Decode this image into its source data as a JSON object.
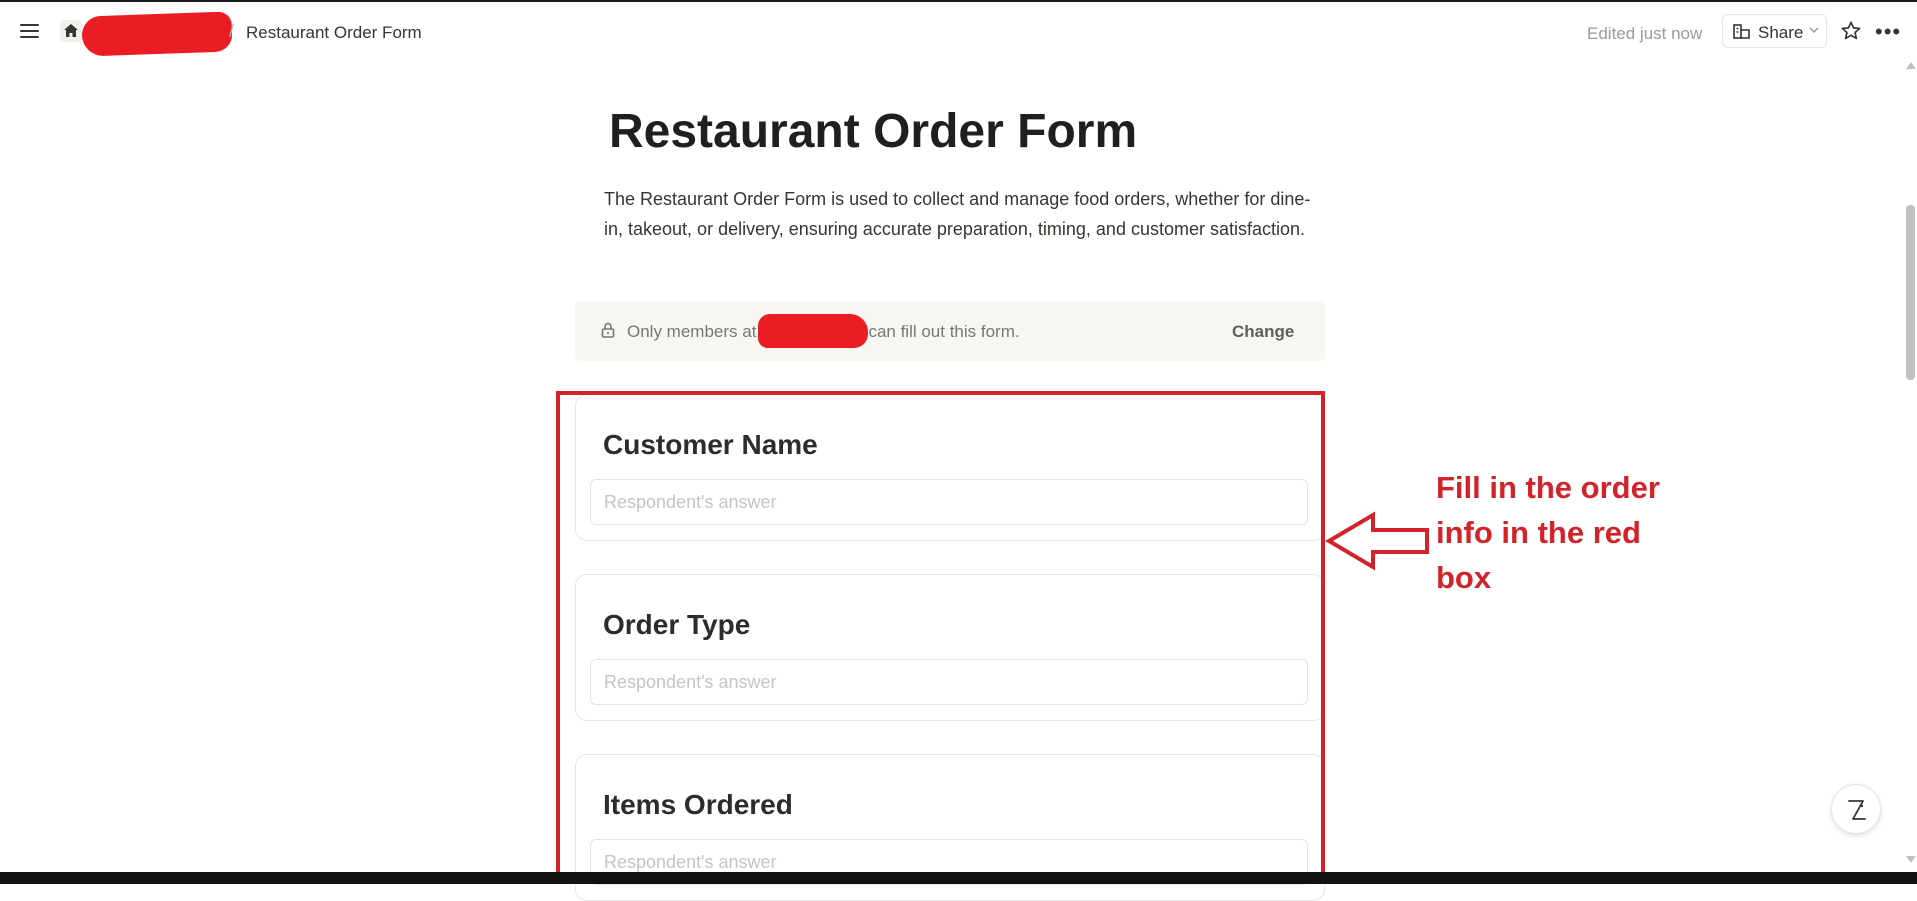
{
  "header": {
    "breadcrumb_title": "Restaurant Order Form",
    "breadcrumb_separator": "/",
    "edited_status": "Edited just now",
    "share_label": "Share",
    "more_label": "•••"
  },
  "page": {
    "title": "Restaurant Order Form",
    "description": "The Restaurant Order Form is used to collect and manage food orders, whether for dine-in, takeout, or delivery, ensuring accurate preparation, timing, and customer satisfaction."
  },
  "notice": {
    "prefix": "Only members at",
    "suffix": "can fill out this form.",
    "change_label": "Change"
  },
  "questions": [
    {
      "label": "Customer Name",
      "placeholder": "Respondent's answer"
    },
    {
      "label": "Order Type",
      "placeholder": "Respondent's answer"
    },
    {
      "label": "Items Ordered",
      "placeholder": "Respondent's answer"
    }
  ],
  "annotation": {
    "text": "Fill in the order info in the red box",
    "color": "#d2232a"
  },
  "icons": {
    "menu": "hamburger-icon",
    "home": "home-icon",
    "share": "share-page-icon",
    "star": "star-icon",
    "lock": "lock-icon",
    "help": "help-icon"
  },
  "colors": {
    "redaction": "#ec1c24",
    "text": "#37352f",
    "muted": "#9b9a97"
  }
}
